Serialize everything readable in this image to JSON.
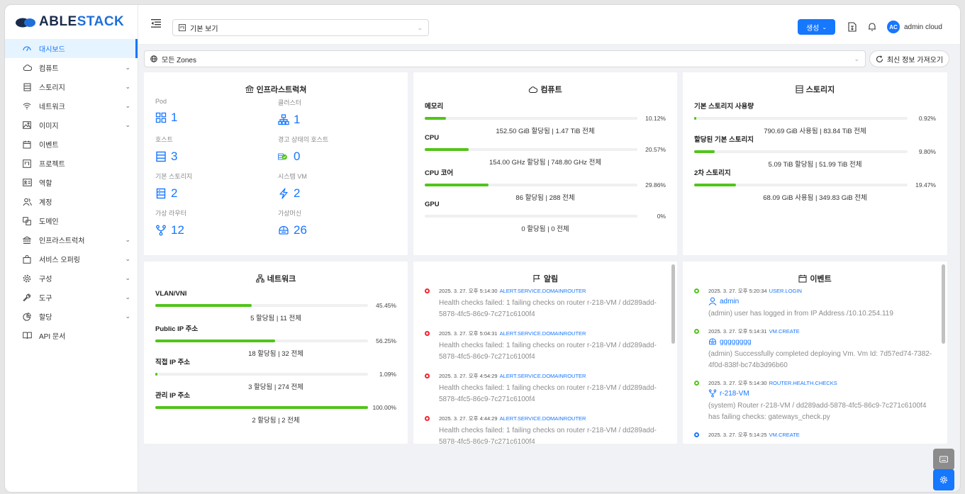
{
  "brand": {
    "prefix": "ABLE",
    "suffix": "STACK"
  },
  "sidebar": {
    "items": [
      {
        "icon": "dashboard-icon",
        "label": "대시보드",
        "active": true,
        "chevron": false
      },
      {
        "icon": "cloud-icon",
        "label": "컴퓨트",
        "chevron": true
      },
      {
        "icon": "storage-icon",
        "label": "스토리지",
        "chevron": true
      },
      {
        "icon": "wifi-icon",
        "label": "네트워크",
        "chevron": true
      },
      {
        "icon": "image-icon",
        "label": "이미지",
        "chevron": true
      },
      {
        "icon": "calendar-icon",
        "label": "이벤트",
        "chevron": false
      },
      {
        "icon": "project-icon",
        "label": "프로젝트",
        "chevron": false
      },
      {
        "icon": "role-icon",
        "label": "역할",
        "chevron": false
      },
      {
        "icon": "team-icon",
        "label": "계정",
        "chevron": false
      },
      {
        "icon": "block-icon",
        "label": "도메인",
        "chevron": false
      },
      {
        "icon": "bank-icon",
        "label": "인프라스트럭처",
        "chevron": true
      },
      {
        "icon": "shopping-icon",
        "label": "서비스 오퍼링",
        "chevron": true
      },
      {
        "icon": "setting-icon",
        "label": "구성",
        "chevron": true
      },
      {
        "icon": "tool-icon",
        "label": "도구",
        "chevron": true
      },
      {
        "icon": "pie-chart-icon",
        "label": "할당",
        "chevron": true
      },
      {
        "icon": "read-icon",
        "label": "API 문서",
        "chevron": false
      }
    ]
  },
  "header": {
    "view_label": "기본 보기",
    "create_label": "생성",
    "avatar_initials": "AC",
    "username": "admin cloud"
  },
  "zone": {
    "label": "모든 Zones"
  },
  "refresh_label": "최신 정보 가져오기",
  "infra": {
    "title": "인프라스트럭쳐",
    "items": [
      {
        "label": "Pod",
        "value": "1",
        "icon": "appstore-icon"
      },
      {
        "label": "클러스터",
        "value": "1",
        "icon": "cluster-icon"
      },
      {
        "label": "호스트",
        "value": "3",
        "icon": "host-icon"
      },
      {
        "label": "경고 상태의 호스트",
        "value": "0",
        "icon": "host-alert-icon"
      },
      {
        "label": "기본 스토리지",
        "value": "2",
        "icon": "primary-storage-icon"
      },
      {
        "label": "시스템 VM",
        "value": "2",
        "icon": "thunderbolt-icon"
      },
      {
        "label": "가상 라우터",
        "value": "12",
        "icon": "fork-icon"
      },
      {
        "label": "가상머신",
        "value": "26",
        "icon": "vm-icon"
      }
    ]
  },
  "compute": {
    "title": "컴퓨트",
    "bars": [
      {
        "name": "메모리",
        "pct": "10.12%",
        "value": 10.12,
        "detail": "152.50 GiB 할당됨 | 1.47 TiB 전체"
      },
      {
        "name": "CPU",
        "pct": "20.57%",
        "value": 20.57,
        "detail": "154.00 GHz 할당됨 | 748.80 GHz 전체"
      },
      {
        "name": "CPU 코어",
        "pct": "29.86%",
        "value": 29.86,
        "detail": "86 할당됨 | 288 전체"
      },
      {
        "name": "GPU",
        "pct": "0%",
        "value": 0,
        "detail": "0 할당됨 | 0 전체"
      }
    ]
  },
  "storage": {
    "title": "스토리지",
    "bars": [
      {
        "name": "기본 스토리지 사용량",
        "pct": "0.92%",
        "value": 0.92,
        "detail": "790.69 GiB 사용됨 | 83.84 TiB 전체"
      },
      {
        "name": "할당된 기본 스토리지",
        "pct": "9.80%",
        "value": 9.8,
        "detail": "5.09 TiB 할당됨 | 51.99 TiB 전체"
      },
      {
        "name": "2차 스토리지",
        "pct": "19.47%",
        "value": 19.47,
        "detail": "68.09 GiB 사용됨 | 349.83 GiB 전체"
      }
    ]
  },
  "network": {
    "title": "네트워크",
    "bars": [
      {
        "name": "VLAN/VNI",
        "pct": "45.45%",
        "value": 45.45,
        "detail": "5 할당됨 | 11 전체"
      },
      {
        "name": "Public IP 주소",
        "pct": "56.25%",
        "value": 56.25,
        "detail": "18 할당됨 | 32 전체"
      },
      {
        "name": "직접 IP 주소",
        "pct": "1.09%",
        "value": 1.09,
        "detail": "3 할당됨 | 274 전체"
      },
      {
        "name": "관리 IP 주소",
        "pct": "100.00%",
        "value": 100,
        "detail": "2 할당됨 | 2 전체"
      }
    ]
  },
  "alerts": {
    "title": "알림",
    "items": [
      {
        "time": "2025. 3. 27. 오후 5:14:30",
        "type": "ALERT.SERVICE.DOMAINROUTER",
        "text": "Health checks failed: 1 failing checks on router r-218-VM / dd289add-5878-4fc5-86c9-7c271c6100f4"
      },
      {
        "time": "2025. 3. 27. 오후 5:04:31",
        "type": "ALERT.SERVICE.DOMAINROUTER",
        "text": "Health checks failed: 1 failing checks on router r-218-VM / dd289add-5878-4fc5-86c9-7c271c6100f4"
      },
      {
        "time": "2025. 3. 27. 오후 4:54:29",
        "type": "ALERT.SERVICE.DOMAINROUTER",
        "text": "Health checks failed: 1 failing checks on router r-218-VM / dd289add-5878-4fc5-86c9-7c271c6100f4"
      },
      {
        "time": "2025. 3. 27. 오후 4:44:29",
        "type": "ALERT.SERVICE.DOMAINROUTER",
        "text": "Health checks failed: 1 failing checks on router r-218-VM / dd289add-5878-4fc5-86c9-7c271c6100f4"
      }
    ]
  },
  "events": {
    "title": "이벤트",
    "items": [
      {
        "time": "2025. 3. 27. 오후 5:20:34",
        "type": "USER.LOGIN",
        "link": "admin",
        "link_icon": "user-icon",
        "text": "(admin) user has logged in from IP Address /10.10.254.119",
        "color": "#52c41a"
      },
      {
        "time": "2025. 3. 27. 오후 5:14:31",
        "type": "VM.CREATE",
        "link": "gggggggg",
        "link_icon": "vm-icon",
        "text": "(admin) Successfully completed deploying Vm. Vm Id: 7d57ed74-7382-4f0d-838f-bc74b3d96b60",
        "color": "#52c41a"
      },
      {
        "time": "2025. 3. 27. 오후 5:14:30",
        "type": "ROUTER.HEALTH.CHECKS",
        "link": "r-218-VM",
        "link_icon": "fork-icon",
        "text": "(system) Router r-218-VM / dd289add-5878-4fc5-86c9-7c271c6100f4 has failing checks: gateways_check.py",
        "color": "#52c41a"
      },
      {
        "time": "2025. 3. 27. 오후 5:14:25",
        "type": "VM.CREATE",
        "link": "",
        "link_icon": "",
        "text": "",
        "color": "#1677ff"
      }
    ]
  },
  "colors": {
    "accent": "#1677ff",
    "success": "#52c41a",
    "error": "#f5222d"
  }
}
